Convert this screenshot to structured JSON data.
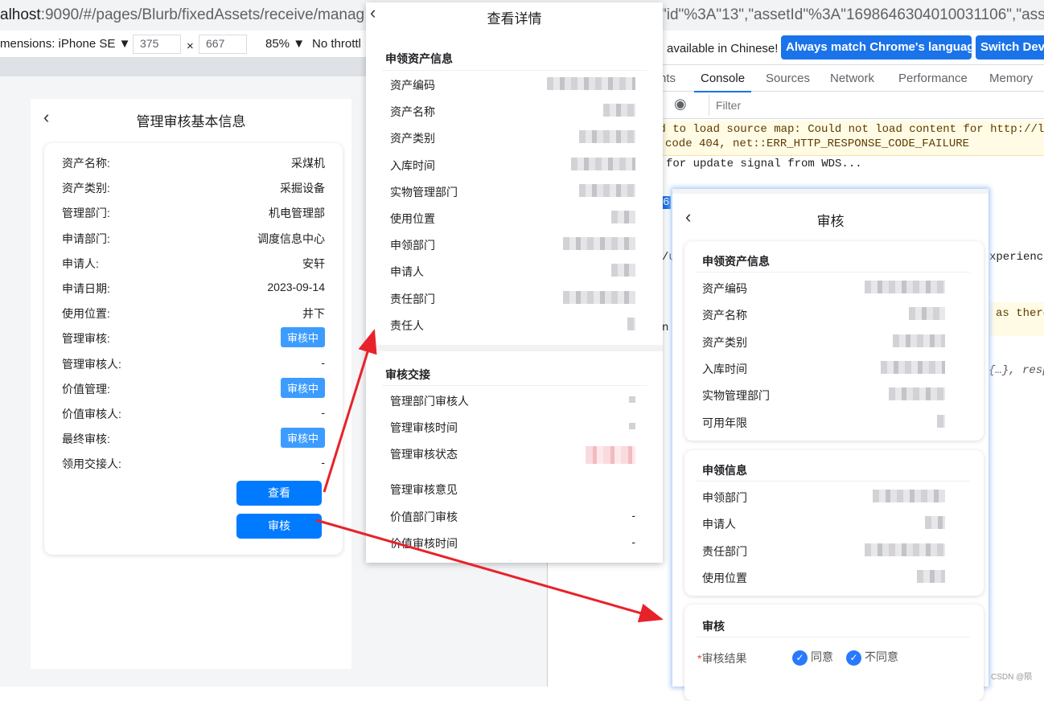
{
  "browser": {
    "url_left_host": "alhost",
    "url_left_path": ":9090/#/pages/Blurb/fixedAssets/receive/manag",
    "url_right": "\"id\"%3A\"13\",\"assetId\"%3A\"1698646304010031106\",\"asse"
  },
  "device_toolbar": {
    "dimensions": "mensions: iPhone SE ▼",
    "width": "375",
    "times": "×",
    "height": "667",
    "zoom": "85% ▼",
    "throttle": "No throttl"
  },
  "devtools": {
    "lang_msg": "available in Chinese!",
    "btn_match": "Always match Chrome's language",
    "btn_switch": "Switch DevT",
    "tabs": [
      "nts",
      "Console",
      "Sources",
      "Network",
      "Performance",
      "Memory"
    ],
    "filter_placeholder": "Filter",
    "warn1": "ed to load source map: Could not load content for http://l",
    "warn2": "code 404, net::ERR_HTTP_RESPONSE_CODE_FAILURE",
    "log1": "for update signal from WDS...",
    "frag": [
      "6",
      "/u",
      "xperience",
      "as there",
      "n",
      "{…}, resp"
    ]
  },
  "left_page": {
    "title": "管理审核基本信息",
    "rows": [
      {
        "k": "资产名称:",
        "v": "采煤机"
      },
      {
        "k": "资产类别:",
        "v": "采掘设备"
      },
      {
        "k": "管理部门:",
        "v": "机电管理部"
      },
      {
        "k": "申请部门:",
        "v": "调度信息中心"
      },
      {
        "k": "申请人:",
        "v": "安轩"
      },
      {
        "k": "申请日期:",
        "v": "2023-09-14"
      },
      {
        "k": "使用位置:",
        "v": "井下"
      },
      {
        "k": "管理审核:",
        "badge": "审核中"
      },
      {
        "k": "管理审核人:",
        "v": "-"
      },
      {
        "k": "价值管理:",
        "badge": "审核中"
      },
      {
        "k": "价值审核人:",
        "v": "-"
      },
      {
        "k": "最终审核:",
        "badge": "审核中"
      },
      {
        "k": "领用交接人:",
        "v": "-"
      }
    ],
    "btn_view": "查看",
    "btn_audit": "审核"
  },
  "detail_page": {
    "title": "查看详情",
    "sec1": "申领资产信息",
    "rows1": [
      "资产编码",
      "资产名称",
      "资产类别",
      "入库时间",
      "实物管理部门",
      "使用位置",
      "申领部门",
      "申请人",
      "责任部门",
      "责任人"
    ],
    "sec2": "审核交接",
    "rows2": [
      "管理部门审核人",
      "管理审核时间",
      "管理审核状态",
      "管理审核意见",
      "价值部门审核",
      "价值审核时间"
    ],
    "dash": "-"
  },
  "audit_page": {
    "title": "审核",
    "sec1": "申领资产信息",
    "rows1": [
      "资产编码",
      "资产名称",
      "资产类别",
      "入库时间",
      "实物管理部门",
      "可用年限"
    ],
    "sec2": "申领信息",
    "rows2": [
      "申领部门",
      "申请人",
      "责任部门",
      "使用位置"
    ],
    "sec3": "审核",
    "required": "*",
    "result_label": "审核结果",
    "opt1": "同意",
    "opt2": "不同意"
  },
  "watermark": "CSDN @陨",
  "colors": {
    "primary": "#007aff",
    "badge": "#3c9cff",
    "arrow": "#e8222a",
    "chrome_blue": "#1a73e8"
  }
}
